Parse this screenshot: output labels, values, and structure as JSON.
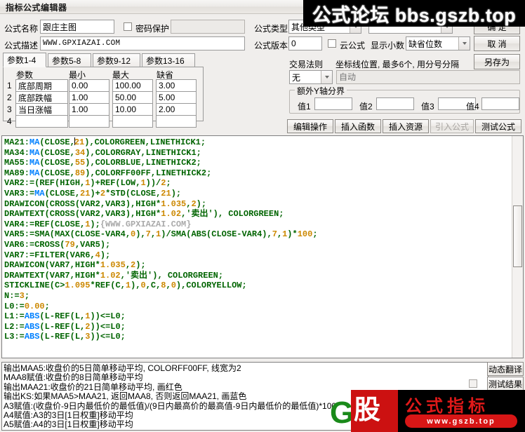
{
  "window": {
    "title": "指标公式编辑器"
  },
  "form": {
    "name_label": "公式名称",
    "name_value": "跟庄主图",
    "password_label": "密码保护",
    "password_value": "",
    "desc_label": "公式描述",
    "desc_value": "WWW.GPXIAZAI.COM",
    "type_label": "公式类型",
    "type_value": "其他类型",
    "version_label": "公式版本",
    "version_value": "0",
    "cloud_label": "云公式",
    "decimal_label": "显示小数",
    "decimal_value": "缺省位数",
    "trade_rule_label": "交易法则",
    "trade_rule_value": "无",
    "coord_label": "坐标线位置, 最多6个, 用分号分隔",
    "coord_placeholder": "自动",
    "yaxis_group_label": "额外Y轴分界",
    "yaxis_values": [
      {
        "label": "值1",
        "value": ""
      },
      {
        "label": "值2",
        "value": ""
      },
      {
        "label": "值3",
        "value": ""
      },
      {
        "label": "值4",
        "value": ""
      }
    ]
  },
  "buttons": {
    "ok": "确  定",
    "cancel": "取  消",
    "save_as": "另存为",
    "edit_op": "编辑操作",
    "insert_func": "插入函数",
    "insert_res": "插入资源",
    "import_formula": "引入公式",
    "test_formula": "测试公式",
    "dynamic_translate": "动态翻译",
    "test_result": "测试结果"
  },
  "param_tabs": [
    {
      "label": "参数1-4",
      "active": true
    },
    {
      "label": "参数5-8",
      "active": false
    },
    {
      "label": "参数9-12",
      "active": false
    },
    {
      "label": "参数13-16",
      "active": false
    }
  ],
  "param_table": {
    "headers": [
      "参数",
      "最小",
      "最大",
      "缺省"
    ],
    "rows": [
      {
        "num": "1",
        "name": "底部周期",
        "min": "0.00",
        "max": "100.00",
        "def": "3.00"
      },
      {
        "num": "2",
        "name": "底部跌幅",
        "min": "1.00",
        "max": "50.00",
        "def": "5.00"
      },
      {
        "num": "3",
        "name": "当日涨幅",
        "min": "1.00",
        "max": "10.00",
        "def": "2.00"
      },
      {
        "num": "4",
        "name": "",
        "min": "",
        "max": "",
        "def": ""
      }
    ]
  },
  "code_lines": [
    "MA21:MA(CLOSE,21),COLORGREEN,LINETHICK1;",
    "MA34:MA(CLOSE,34),COLORGRAY,LINETHICK1;",
    "MA55:MA(CLOSE,55),COLORBLUE,LINETHICK2;",
    "MA89:MA(CLOSE,89),COLORFF00FF,LINETHICK2;",
    "VAR2:=(REF(HIGH,1)+REF(LOW,1))/2;",
    "VAR3:=MA(CLOSE,21)+2*STD(CLOSE,21);",
    "DRAWICON(CROSS(VAR2,VAR3),HIGH*1.035,2);",
    "DRAWTEXT(CROSS(VAR2,VAR3),HIGH*1.02,'卖出'), COLORGREEN;",
    "VAR4:=REF(CLOSE,1);{WWW.GPXIAZAI.COM}",
    "VAR5:=SMA(MAX(CLOSE-VAR4,0),7,1)/SMA(ABS(CLOSE-VAR4),7,1)*100;",
    "VAR6:=CROSS(79,VAR5);",
    "VAR7:=FILTER(VAR6,4);",
    "DRAWICON(VAR7,HIGH*1.035,2);",
    "DRAWTEXT(VAR7,HIGH*1.02,'卖出'), COLORGREEN;",
    "STICKLINE(C>1.095*REF(C,1),0,C,8,0),COLORYELLOW;",
    "N:=3;",
    "L0:=0.00;",
    "L1:=ABS(L-REF(L,1))<=L0;",
    "L2:=ABS(L-REF(L,2))<=L0;",
    "L3:=ABS(L-REF(L,3))<=L0;"
  ],
  "output_lines": [
    "输出MAA5:收盘价的5日简单移动平均, COLORFF00FF, 线宽为2",
    "MAA8赋值:收盘价的8日简单移动平均",
    "输出MAA21:收盘价的21日简单移动平均, 画红色",
    "输出KS:如果MAA5>MAA21, 返回MAA8, 否则返回MAA21, 画蓝色",
    "A3赋值:(收盘价-9日内最低价的最低值)/(9日内最高价的最高值-9日内最低价的最低值)*100",
    "A4赋值:A3的3日[1日权重]移动平均",
    "A5赋值:A4的3日[1日权重]移动平均"
  ],
  "watermarks": {
    "top": "公式论坛 bbs.gszb.top",
    "bottom_brand": "股",
    "bottom_title": "公式指标",
    "bottom_url": "www.gszb.top",
    "gf_logo": "GF"
  },
  "colors": {
    "code_green": "#006400",
    "code_blue": "#0080ff",
    "code_orange": "#cc8800",
    "code_comment": "#aaaaaa",
    "watermark_red": "#cc1111",
    "logo_green": "#1a8a1a"
  }
}
